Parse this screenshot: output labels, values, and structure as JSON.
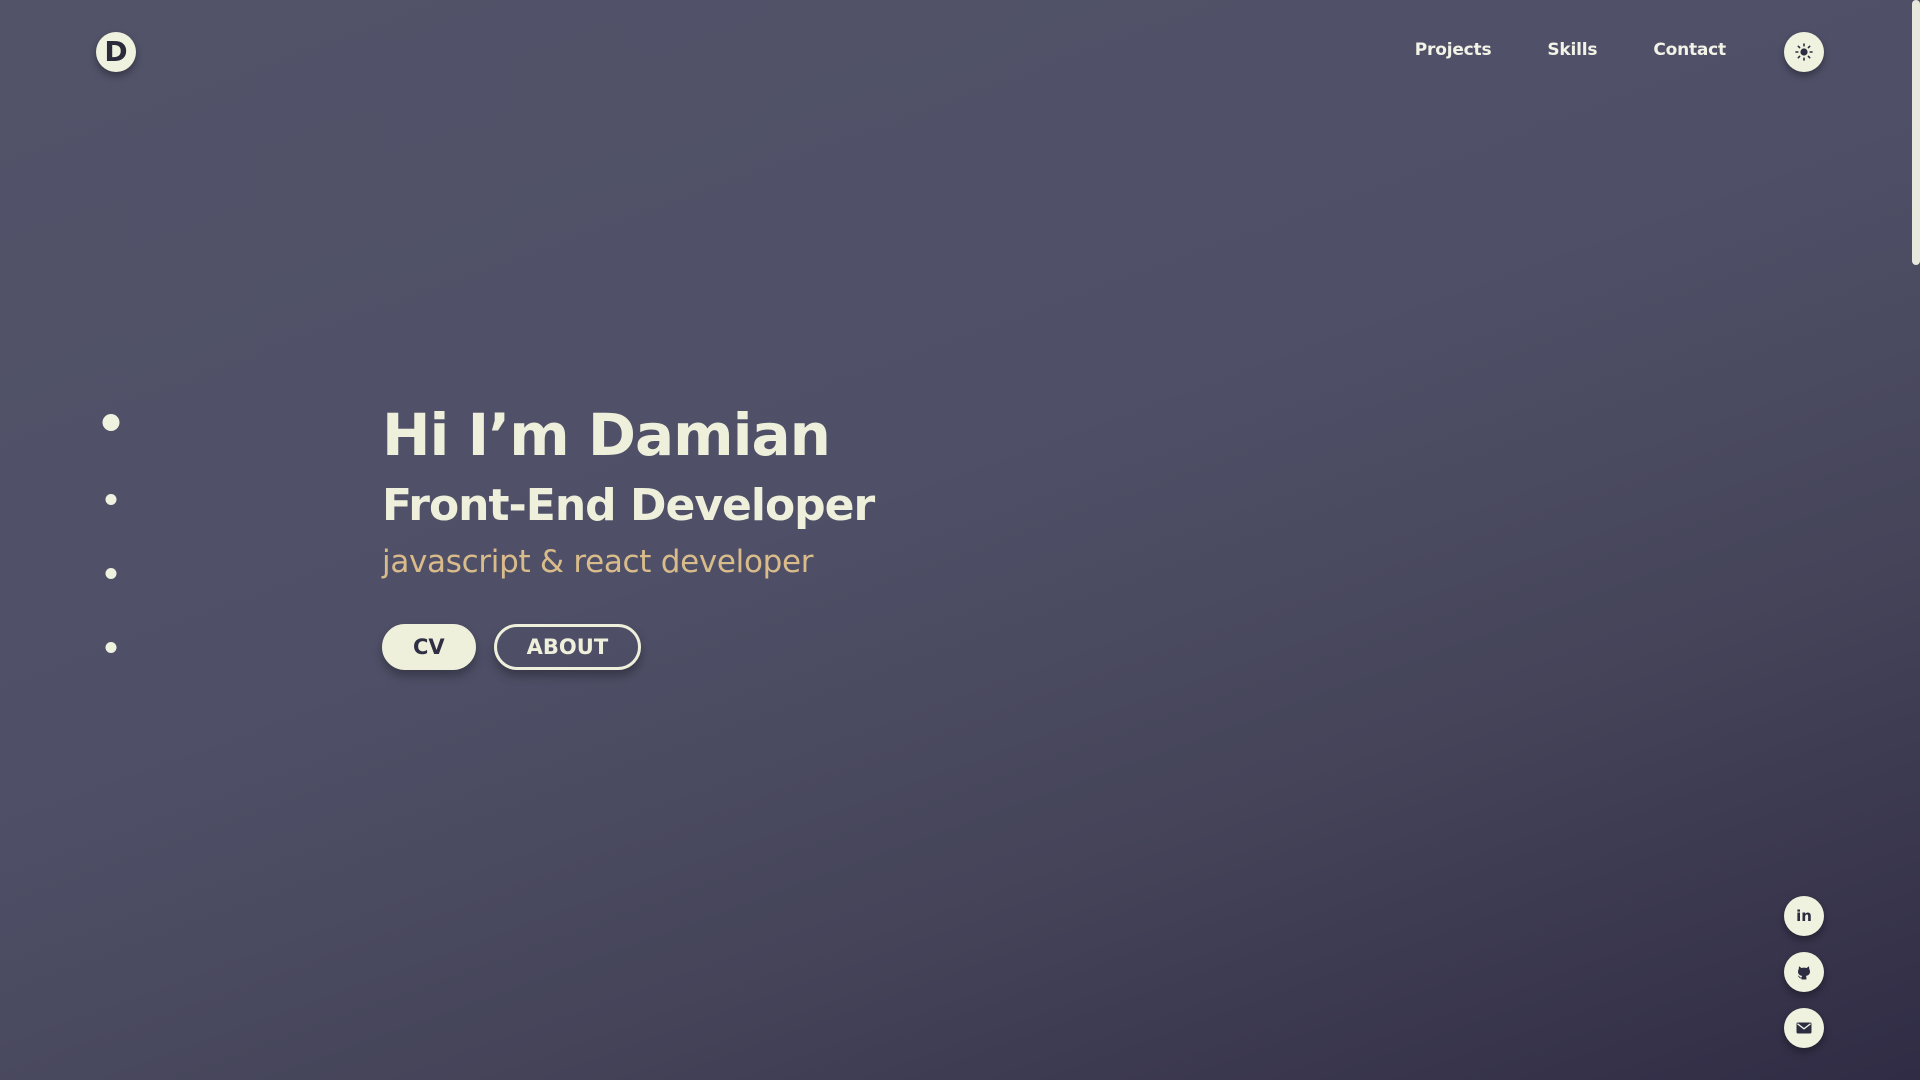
{
  "logo": {
    "letter": "D"
  },
  "nav": {
    "items": [
      {
        "label": "Projects"
      },
      {
        "label": "Skills"
      },
      {
        "label": "Contact"
      }
    ]
  },
  "theme_toggle": {
    "icon": "sun-icon"
  },
  "section_dots": {
    "count": 4,
    "active_index": 0
  },
  "hero": {
    "title": "Hi I’m Damian",
    "subtitle": "Front-End Developer",
    "tagline": "javascript & react developer",
    "buttons": {
      "cv": "CV",
      "about": "ABOUT"
    }
  },
  "social": {
    "linkedin": {
      "text": "in",
      "icon": "linkedin-icon"
    },
    "github": {
      "icon": "github-icon"
    },
    "email": {
      "icon": "mail-icon"
    }
  },
  "colors": {
    "accent": "#eef0db",
    "tagline": "#d9bc8a",
    "background_top": "#525369",
    "background_bottom": "#302c45"
  }
}
